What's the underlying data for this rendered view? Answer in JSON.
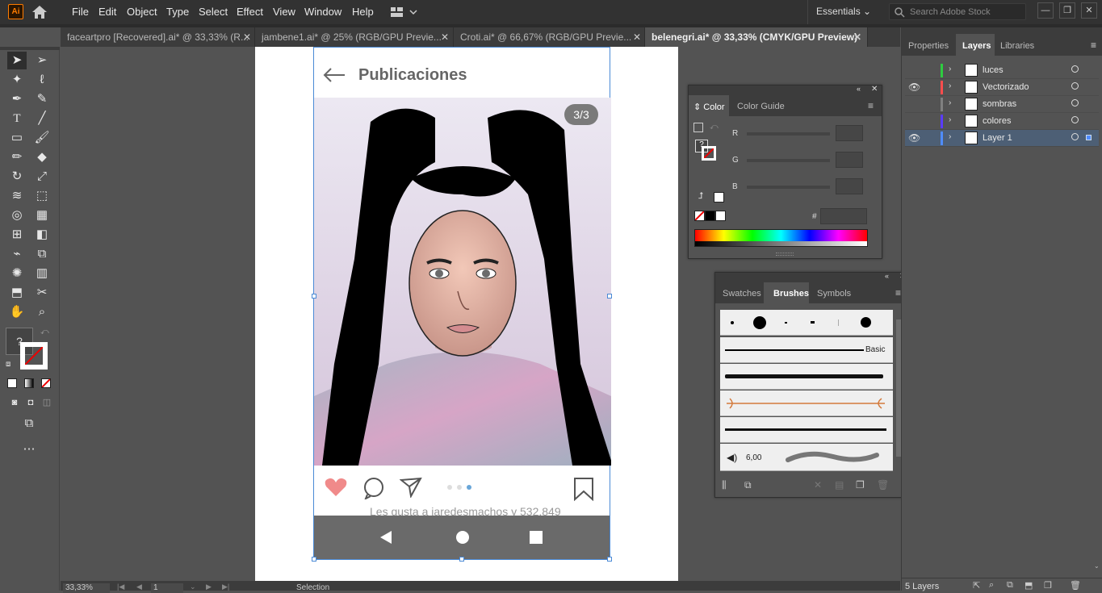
{
  "app": {
    "logo": "Ai",
    "menus": [
      "File",
      "Edit",
      "Object",
      "Type",
      "Select",
      "Effect",
      "View",
      "Window",
      "Help"
    ],
    "workspace": "Essentials",
    "search_placeholder": "Search Adobe Stock"
  },
  "doc_tabs": [
    {
      "label": "faceartpro [Recovered].ai* @ 33,33% (R...",
      "active": false
    },
    {
      "label": "jambene1.ai* @ 25% (RGB/GPU Previe...",
      "active": false
    },
    {
      "label": "Croti.ai* @ 66,67% (RGB/GPU Previe...",
      "active": false
    },
    {
      "label": "belenegri.ai* @ 33,33% (CMYK/GPU Preview)",
      "active": true
    }
  ],
  "tools": [
    "selection-tool",
    "direct-selection-tool",
    "magic-wand-tool",
    "lasso-tool",
    "pen-tool",
    "curvature-tool",
    "type-tool",
    "line-tool",
    "rectangle-tool",
    "paintbrush-tool",
    "pencil-tool",
    "eraser-tool",
    "rotate-tool",
    "scale-tool",
    "width-tool",
    "free-transform-tool",
    "shape-builder-tool",
    "perspective-grid-tool",
    "mesh-tool",
    "gradient-tool",
    "eyedropper-tool",
    "blend-tool",
    "symbol-sprayer-tool",
    "column-graph-tool",
    "artboard-tool",
    "slice-tool",
    "hand-tool",
    "zoom-tool"
  ],
  "artwork": {
    "header_title": "Publicaciones",
    "counter": "3/3",
    "caption_partial": "Les gusta a jaredesmachos y 532.849"
  },
  "status": {
    "zoom": "33,33%",
    "page": "1",
    "tool": "Selection"
  },
  "right_tabs": [
    "Properties",
    "Layers",
    "Libraries"
  ],
  "layers": [
    {
      "name": "luces",
      "color": "#2ecc40",
      "visible": false,
      "selected": false
    },
    {
      "name": "Vectorizado",
      "color": "#ff4d4d",
      "visible": true,
      "selected": false
    },
    {
      "name": "sombras",
      "color": "#808080",
      "visible": false,
      "selected": false
    },
    {
      "name": "colores",
      "color": "#5a3cff",
      "visible": false,
      "selected": false
    },
    {
      "name": "Layer 1",
      "color": "#4f8cff",
      "visible": true,
      "selected": true
    }
  ],
  "layers_count": "5 Layers",
  "color_panel": {
    "tabs": [
      "Color",
      "Color Guide"
    ],
    "labels": [
      "R",
      "G",
      "B"
    ],
    "hash": "#"
  },
  "brushes_panel": {
    "tabs": [
      "Swatches",
      "Brushes",
      "Symbols"
    ],
    "basic_label": "Basic",
    "size_value": "6,00"
  }
}
